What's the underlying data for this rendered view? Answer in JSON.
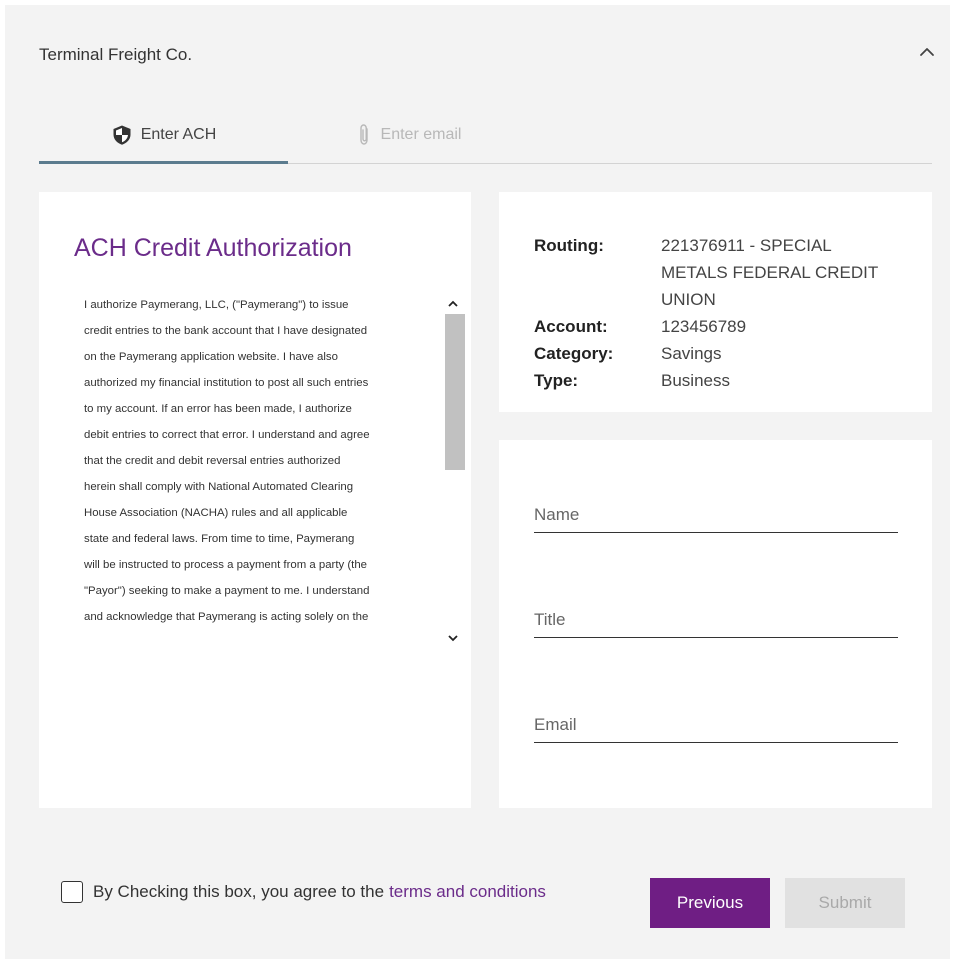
{
  "header": {
    "company_name": "Terminal Freight Co.",
    "collapse_icon": "chevron-up-icon"
  },
  "tabs": [
    {
      "label": "Enter ACH",
      "icon": "shield-icon",
      "active": true
    },
    {
      "label": "Enter email",
      "icon": "paperclip-icon",
      "active": false
    }
  ],
  "authorization": {
    "title": "ACH Credit Authorization",
    "lines": [
      "I authorize Paymerang, LLC, (\"Paymerang\") to issue",
      "credit entries to the bank account that I have designated",
      "on the Paymerang application website. I have also",
      "authorized my financial institution to post all such entries",
      "to my account. If an error has been made, I authorize",
      "debit entries to correct that error. I understand and agree",
      "that the credit and debit reversal entries authorized",
      "herein shall comply with National Automated Clearing",
      "House Association (NACHA) rules and all applicable",
      "state and federal laws. From time to time, Paymerang",
      "will be instructed to process a payment from a party (the",
      "\"Payor\") seeking to make a payment to me. I understand",
      "and acknowledge that Paymerang is acting solely on the"
    ]
  },
  "account_info": {
    "routing_label": "Routing:",
    "routing_value": "221376911 - SPECIAL METALS FEDERAL CREDIT UNION",
    "account_label": "Account:",
    "account_value": "123456789",
    "category_label": "Category:",
    "category_value": "Savings",
    "type_label": "Type:",
    "type_value": "Business"
  },
  "form": {
    "name_placeholder": "Name",
    "title_placeholder": "Title",
    "email_placeholder": "Email"
  },
  "footer": {
    "terms_prefix": "By Checking this box, you agree to the",
    "terms_link": "terms and conditions",
    "previous_label": "Previous",
    "submit_label": "Submit"
  },
  "colors": {
    "accent": "#6f1e84",
    "title_purple": "#6b2c8a",
    "tab_underline": "#5b7b8e",
    "panel_bg": "#f3f3f3",
    "disabled_bg": "#e1e1e1"
  }
}
